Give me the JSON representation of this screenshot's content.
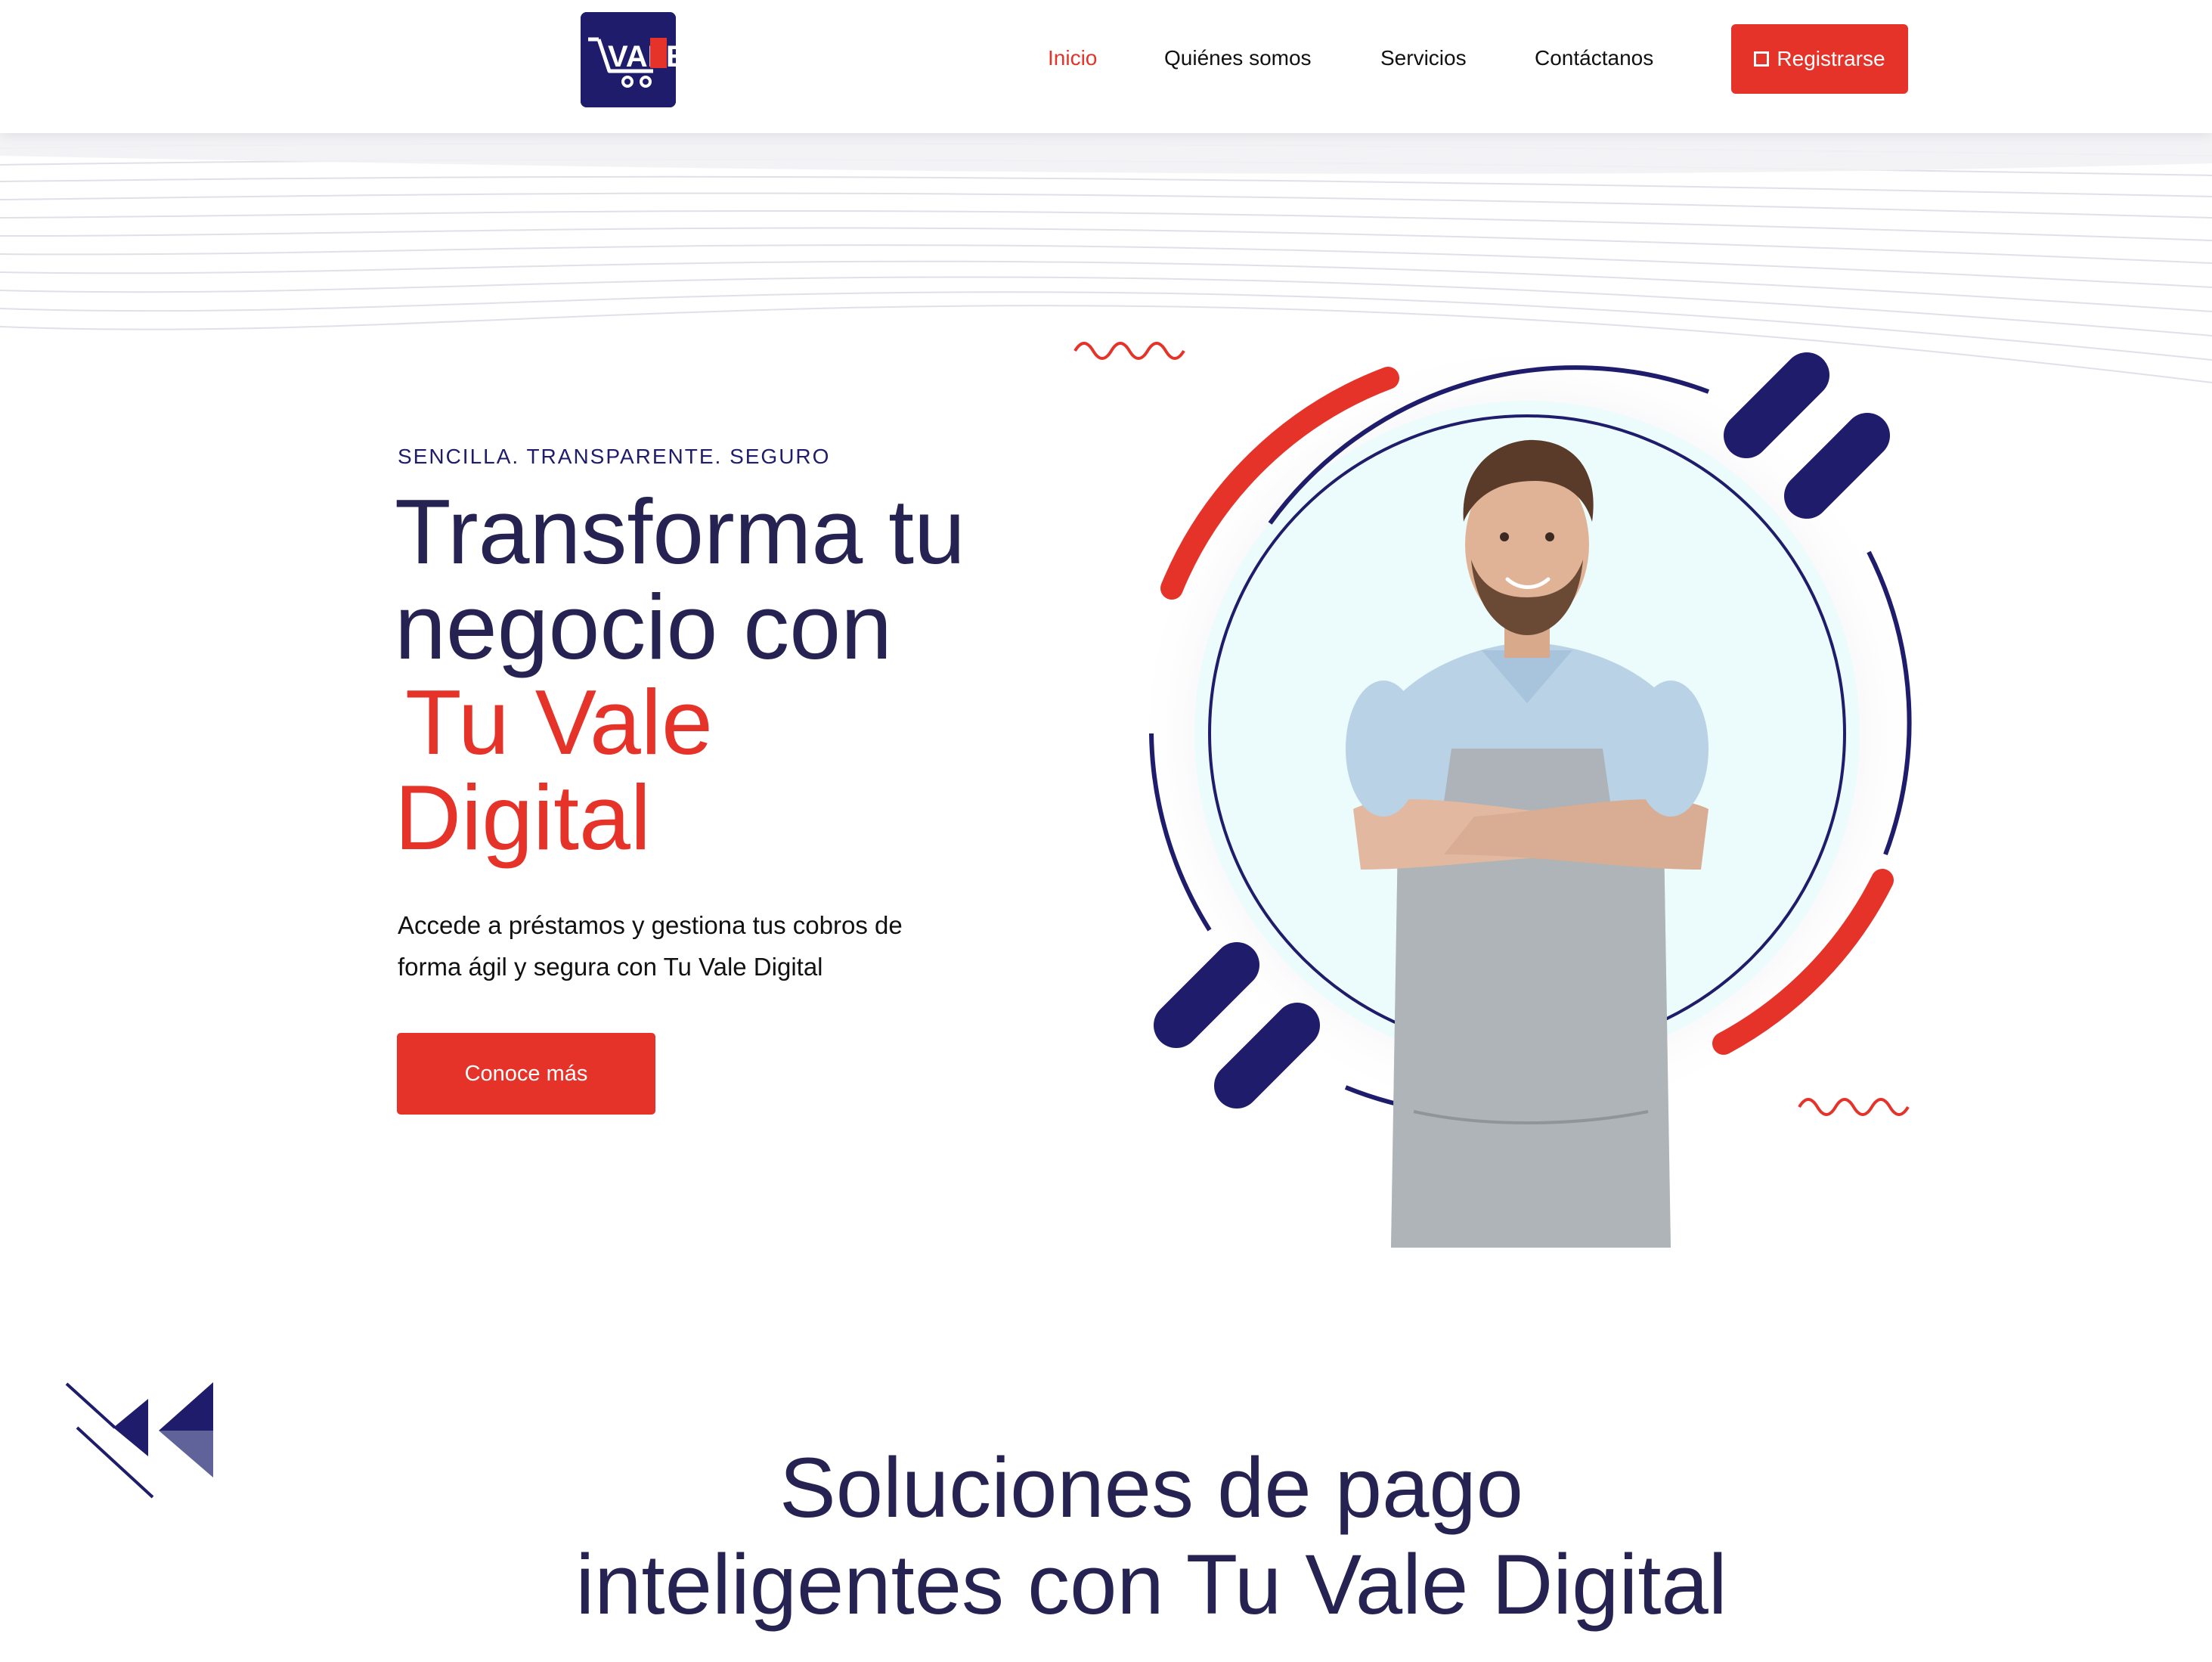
{
  "header": {
    "logo_text": "VALE",
    "nav": [
      {
        "label": "Inicio",
        "active": true
      },
      {
        "label": "Quiénes somos",
        "active": false
      },
      {
        "label": "Servicios",
        "active": false
      },
      {
        "label": "Contáctanos",
        "active": false
      }
    ],
    "register_label": "Registrarse"
  },
  "hero": {
    "eyebrow": "SENCILLA. TRANSPARENTE. SEGURO",
    "title_line1": "Transforma tu",
    "title_line2": "negocio con",
    "title_accent1": "Tu Vale",
    "title_accent2": "Digital",
    "description": "Accede a préstamos y gestiona tus cobros de forma ágil y segura con Tu Vale Digital",
    "cta_label": "Conoce más"
  },
  "section2": {
    "title_line1": "Soluciones de pago",
    "title_line2": "inteligentes con Tu Vale Digital"
  },
  "colors": {
    "accent": "#e6332a",
    "navy": "#1f1c6b",
    "heading": "#262352",
    "circle_fill": "#ecfbfb"
  },
  "icons": [
    "cart-logo-icon",
    "square-icon",
    "zigzag-icon",
    "arrows-decoration-icon"
  ]
}
